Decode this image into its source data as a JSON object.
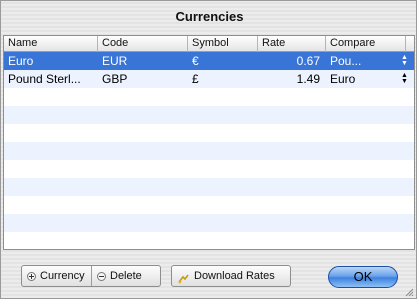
{
  "window": {
    "title": "Currencies"
  },
  "table": {
    "columns": [
      "Name",
      "Code",
      "Symbol",
      "Rate",
      "Compare"
    ],
    "rows": [
      {
        "name": "Euro",
        "code": "EUR",
        "symbol": "€",
        "rate": "0.67",
        "compare": "Pou..."
      },
      {
        "name": "Pound Sterl...",
        "code": "GBP",
        "symbol": "£",
        "rate": "1.49",
        "compare": "Euro"
      }
    ],
    "selected_row": 0
  },
  "toolbar": {
    "add_label": "Currency",
    "delete_label": "Delete",
    "download_label": "Download Rates",
    "ok_label": "OK"
  },
  "icons": {
    "add": "plus-icon",
    "delete": "minus-icon",
    "download": "download-rates-icon",
    "stepper": "stepper-arrows-icon",
    "resize": "resize-grip-icon"
  },
  "colors": {
    "selection": "#3875d7",
    "alt_row": "#edf3fe",
    "ok_button": "#5a98e8"
  }
}
